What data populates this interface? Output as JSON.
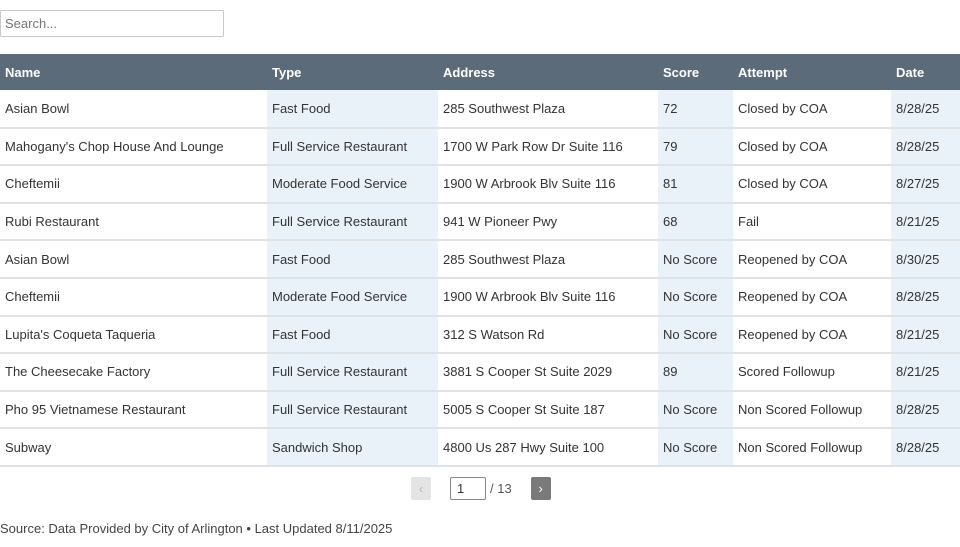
{
  "search": {
    "placeholder": "Search..."
  },
  "table": {
    "headers": [
      "Name",
      "Type",
      "Address",
      "Score",
      "Attempt",
      "Date"
    ],
    "rows": [
      [
        "Asian Bowl",
        "Fast Food",
        "285 Southwest Plaza",
        "72",
        "Closed by COA",
        "8/28/25"
      ],
      [
        "Mahogany's Chop House And Lounge",
        "Full Service Restaurant",
        "1700 W Park Row Dr Suite 116",
        "79",
        "Closed by COA",
        "8/28/25"
      ],
      [
        "Cheftemii",
        "Moderate Food Service",
        "1900 W Arbrook Blv Suite 116",
        "81",
        "Closed by COA",
        "8/27/25"
      ],
      [
        "Rubi Restaurant",
        "Full Service Restaurant",
        "941 W Pioneer Pwy",
        "68",
        "Fail",
        "8/21/25"
      ],
      [
        "Asian Bowl",
        "Fast Food",
        "285 Southwest Plaza",
        "No Score",
        "Reopened by COA",
        "8/30/25"
      ],
      [
        "Cheftemii",
        "Moderate Food Service",
        "1900 W Arbrook Blv Suite 116",
        "No Score",
        "Reopened by COA",
        "8/28/25"
      ],
      [
        "Lupita's Coqueta Taqueria",
        "Fast Food",
        "312 S Watson Rd",
        "No Score",
        "Reopened by COA",
        "8/21/25"
      ],
      [
        "The Cheesecake Factory",
        "Full Service Restaurant",
        "3881 S Cooper St Suite 2029",
        "89",
        "Scored Followup",
        "8/21/25"
      ],
      [
        "Pho 95 Vietnamese Restaurant",
        "Full Service Restaurant",
        "5005 S Cooper St Suite 187",
        "No Score",
        "Non Scored Followup",
        "8/28/25"
      ],
      [
        "Subway",
        "Sandwich Shop",
        "4800 Us 287 Hwy Suite 100",
        "No Score",
        "Non Scored Followup",
        "8/28/25"
      ]
    ]
  },
  "pagination": {
    "prev_icon": "chevron-left-icon",
    "prev_glyph": "‹",
    "current_page": "1",
    "total_label": "/ 13",
    "next_icon": "chevron-right-icon",
    "next_glyph": "›"
  },
  "footer": {
    "source": "Source: Data Provided by City of Arlington • Last Updated 8/11/2025"
  },
  "colors": {
    "header_bg": "#5b6b79",
    "shade_col": "#e9f2f8",
    "row_border": "#dfe3e6"
  }
}
